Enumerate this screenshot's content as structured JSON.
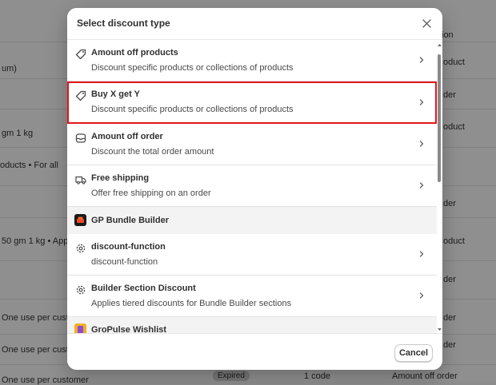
{
  "background": {
    "header_text": "ion",
    "left_snippets": [
      "um)",
      "gm 1 kg",
      "oducts • For all",
      "50 gm 1 kg • Appl",
      "One use per custo",
      "One use per custo",
      "One use per customer"
    ],
    "right_snippets": [
      "oduct",
      "der",
      "oduct",
      "der",
      "oduct",
      "der",
      "der",
      "der"
    ],
    "bottom_row": {
      "status": "Expired",
      "codes": "1 code",
      "type": "Amount off order"
    }
  },
  "modal": {
    "title": "Select discount type",
    "options": [
      {
        "title": "Amount off products",
        "subtitle": "Discount specific products or collections of products",
        "icon": "tag-icon"
      },
      {
        "title": "Buy X get Y",
        "subtitle": "Discount specific products or collections of products",
        "icon": "tag-icon",
        "selected": true
      },
      {
        "title": "Amount off order",
        "subtitle": "Discount the total order amount",
        "icon": "cart-icon"
      },
      {
        "title": "Free shipping",
        "subtitle": "Offer free shipping on an order",
        "icon": "truck-icon"
      }
    ],
    "app_sections": [
      {
        "name": "GP Bundle Builder",
        "icon_color": "#1a1a1a",
        "options": [
          {
            "title": "discount-function",
            "subtitle": "discount-function",
            "icon": "gear-icon"
          },
          {
            "title": "Builder Section Discount",
            "subtitle": "Applies tiered discounts for Bundle Builder sections",
            "icon": "gear-icon"
          }
        ]
      },
      {
        "name": "GroPulse Wishlist",
        "icon_color": "#f2b01e"
      }
    ],
    "cancel_label": "Cancel"
  }
}
